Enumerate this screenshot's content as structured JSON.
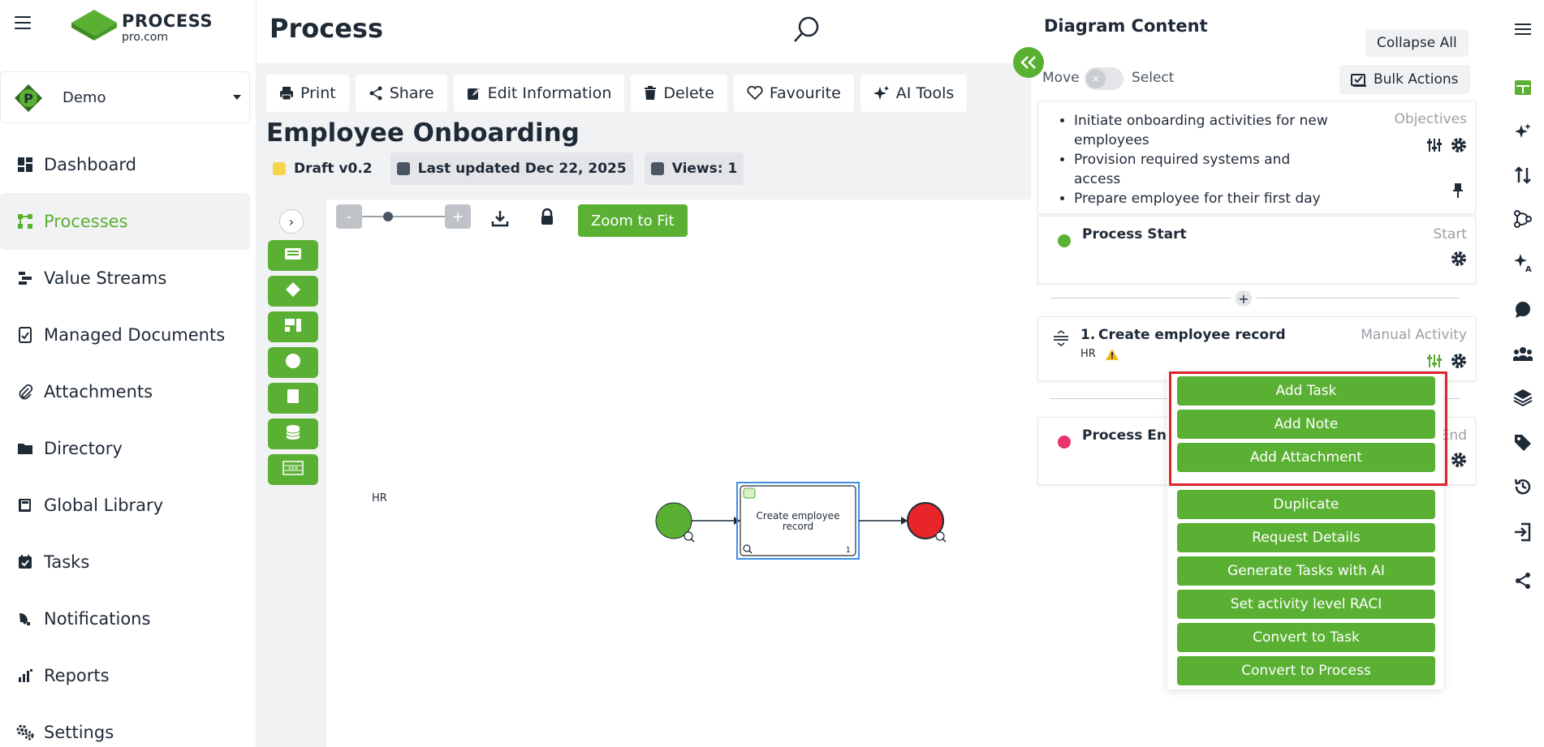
{
  "app": {
    "logo_word": "PROCESS",
    "logo_sub": "pro.com"
  },
  "workspace": {
    "name": "Demo"
  },
  "nav": [
    {
      "label": "Dashboard",
      "icon": "dashboard-icon"
    },
    {
      "label": "Processes",
      "icon": "processes-icon",
      "active": true
    },
    {
      "label": "Value Streams",
      "icon": "value-streams-icon"
    },
    {
      "label": "Managed Documents",
      "icon": "managed-documents-icon"
    },
    {
      "label": "Attachments",
      "icon": "paperclip-icon"
    },
    {
      "label": "Directory",
      "icon": "folder-icon"
    },
    {
      "label": "Global Library",
      "icon": "library-icon"
    },
    {
      "label": "Tasks",
      "icon": "calendar-check-icon"
    },
    {
      "label": "Notifications",
      "icon": "megaphone-icon"
    },
    {
      "label": "Reports",
      "icon": "bar-chart-icon"
    },
    {
      "label": "Settings",
      "icon": "gears-icon"
    }
  ],
  "header": {
    "title": "Process"
  },
  "toolbar": {
    "print": "Print",
    "share": "Share",
    "edit": "Edit Information",
    "delete": "Delete",
    "favourite": "Favourite",
    "ai_tools": "AI Tools"
  },
  "process": {
    "title": "Employee Onboarding",
    "status": "Draft v0.2",
    "updated": "Last updated Dec 22, 2025",
    "views": "Views: 1"
  },
  "canvas": {
    "zoom_minus": "-",
    "zoom_plus": "+",
    "zoom_fit": "Zoom to Fit",
    "lane_label": "HR",
    "activity_label": "Create employee record",
    "activity_number": "1",
    "zoom_level": 0.5
  },
  "panel": {
    "title": "Diagram Content",
    "collapse_all": "Collapse All",
    "move": "Move",
    "select": "Select",
    "bulk_actions": "Bulk Actions",
    "objectives": {
      "type": "Objectives",
      "items": [
        "Initiate onboarding activities for new employees",
        "Provision required systems and access",
        "Prepare employee for their first day"
      ]
    },
    "start": {
      "name": "Process Start",
      "type": "Start"
    },
    "activity": {
      "number": "1.",
      "name": "Create employee record",
      "type": "Manual Activity",
      "role": "HR"
    },
    "end": {
      "name": "Process End",
      "type": "End"
    }
  },
  "menu": {
    "items": [
      "Add Task",
      "Add Note",
      "Add Attachment",
      "Duplicate",
      "Request Details",
      "Generate Tasks with AI",
      "Set activity level RACI",
      "Convert to Task",
      "Convert to Process"
    ]
  },
  "colors": {
    "brand_green": "#5ab033",
    "draft_yellow": "#f7d54a",
    "start_green": "#5ab033",
    "end_red": "#e8262a",
    "highlight_red": "#e0242c",
    "end_dot": "#e8336b"
  }
}
